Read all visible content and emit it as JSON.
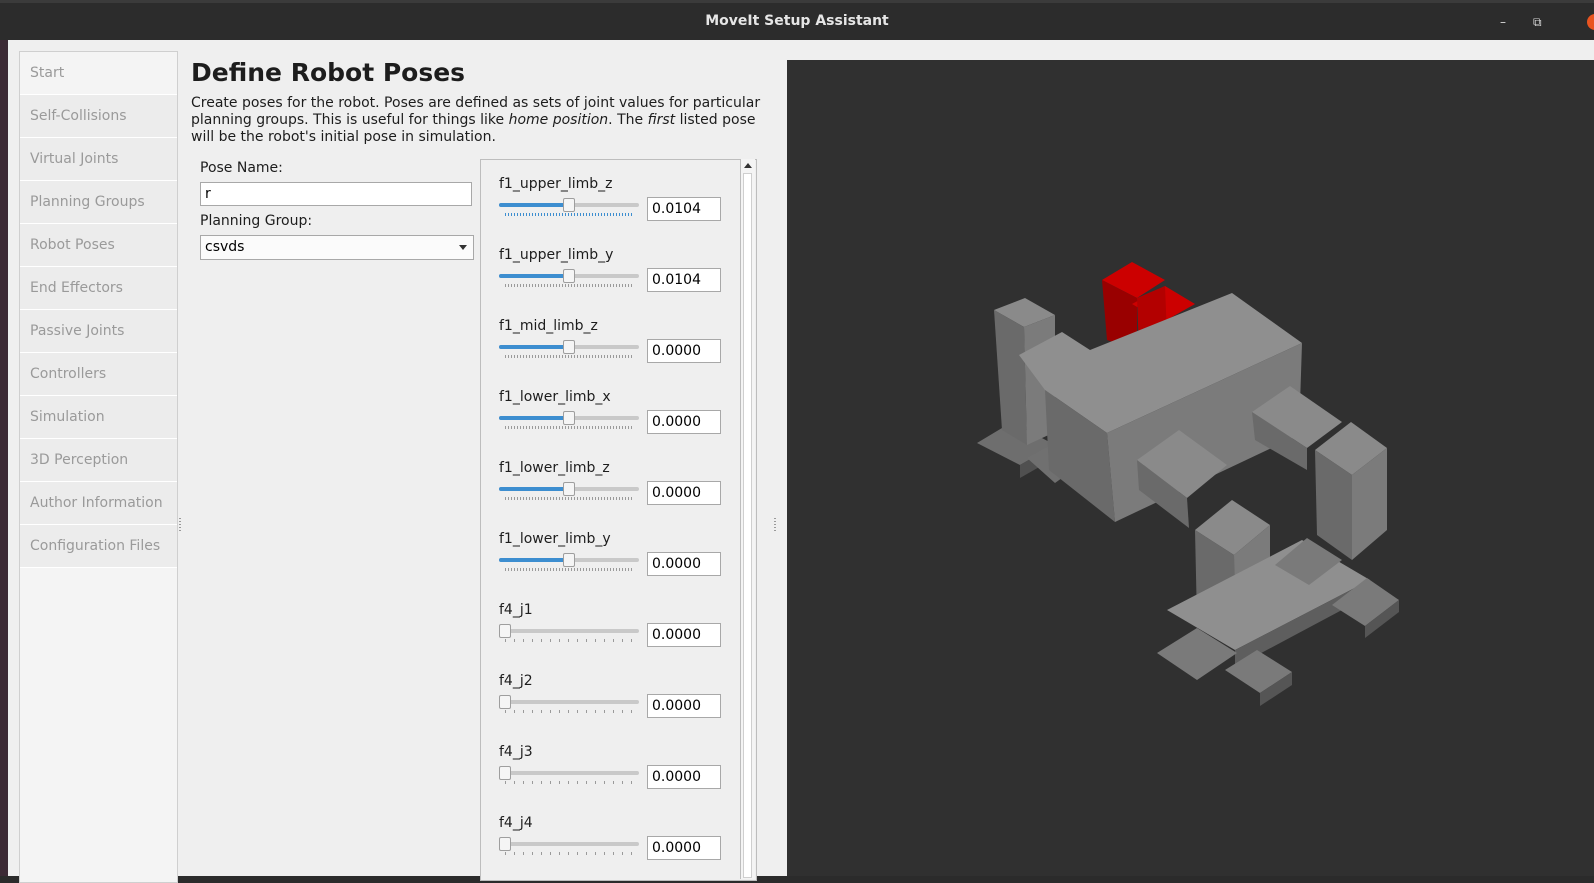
{
  "window": {
    "title": "MoveIt Setup Assistant",
    "minimize_glyph": "–",
    "maximize_glyph": "⧉"
  },
  "sidebar": {
    "items": [
      {
        "label": "Start"
      },
      {
        "label": "Self-Collisions"
      },
      {
        "label": "Virtual Joints"
      },
      {
        "label": "Planning Groups"
      },
      {
        "label": "Robot Poses"
      },
      {
        "label": "End Effectors"
      },
      {
        "label": "Passive Joints"
      },
      {
        "label": "Controllers"
      },
      {
        "label": "Simulation"
      },
      {
        "label": "3D Perception"
      },
      {
        "label": "Author Information"
      },
      {
        "label": "Configuration Files"
      }
    ]
  },
  "page": {
    "title": "Define Robot Poses",
    "desc_1": "Create poses for the robot. Poses are defined as sets of joint values for particular planning groups. This is useful for things like ",
    "desc_em1": "home position",
    "desc_2": ". The ",
    "desc_em2": "first",
    "desc_3": " listed pose will be the robot's initial pose in simulation."
  },
  "form": {
    "pose_name_label": "Pose Name:",
    "pose_name_value": "r",
    "planning_group_label": "Planning Group:",
    "planning_group_value": "csvds"
  },
  "joints": [
    {
      "name": "f1_upper_limb_z",
      "value": "0.0104",
      "slider_fraction": 0.5,
      "ticks_active": true
    },
    {
      "name": "f1_upper_limb_y",
      "value": "0.0104",
      "slider_fraction": 0.5
    },
    {
      "name": "f1_mid_limb_z",
      "value": "0.0000",
      "slider_fraction": 0.5
    },
    {
      "name": "f1_lower_limb_x",
      "value": "0.0000",
      "slider_fraction": 0.5
    },
    {
      "name": "f1_lower_limb_z",
      "value": "0.0000",
      "slider_fraction": 0.5
    },
    {
      "name": "f1_lower_limb_y",
      "value": "0.0000",
      "slider_fraction": 0.5
    },
    {
      "name": "f4_j1",
      "value": "0.0000",
      "slider_fraction": 0.0,
      "sparse": true
    },
    {
      "name": "f4_j2",
      "value": "0.0000",
      "slider_fraction": 0.0,
      "sparse": true
    },
    {
      "name": "f4_j3",
      "value": "0.0000",
      "slider_fraction": 0.0,
      "sparse": true
    },
    {
      "name": "f4_j4",
      "value": "0.0000",
      "slider_fraction": 0.0,
      "sparse": true
    }
  ],
  "colors": {
    "accent": "#3d8ed0",
    "robot_gray": "#808080",
    "robot_highlight": "#cc0000",
    "viewport_bg": "#303030"
  }
}
